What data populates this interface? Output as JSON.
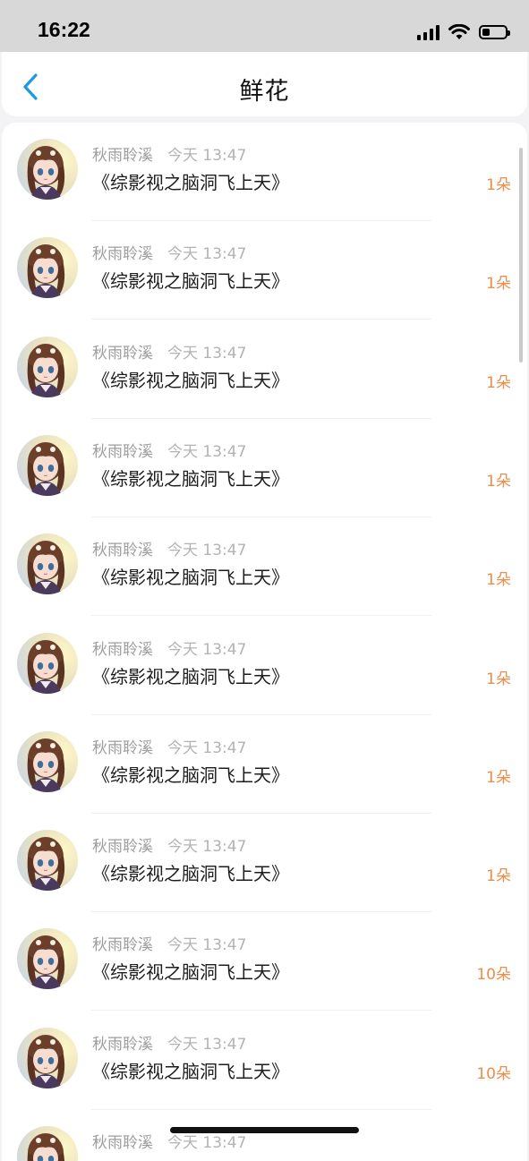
{
  "status_bar": {
    "time": "16:22"
  },
  "nav": {
    "title": "鲜花"
  },
  "list": [
    {
      "name": "秋雨聆溪",
      "time": "今天 13:47",
      "title": "《综影视之脑洞飞上天》",
      "count": "1朵"
    },
    {
      "name": "秋雨聆溪",
      "time": "今天 13:47",
      "title": "《综影视之脑洞飞上天》",
      "count": "1朵"
    },
    {
      "name": "秋雨聆溪",
      "time": "今天 13:47",
      "title": "《综影视之脑洞飞上天》",
      "count": "1朵"
    },
    {
      "name": "秋雨聆溪",
      "time": "今天 13:47",
      "title": "《综影视之脑洞飞上天》",
      "count": "1朵"
    },
    {
      "name": "秋雨聆溪",
      "time": "今天 13:47",
      "title": "《综影视之脑洞飞上天》",
      "count": "1朵"
    },
    {
      "name": "秋雨聆溪",
      "time": "今天 13:47",
      "title": "《综影视之脑洞飞上天》",
      "count": "1朵"
    },
    {
      "name": "秋雨聆溪",
      "time": "今天 13:47",
      "title": "《综影视之脑洞飞上天》",
      "count": "1朵"
    },
    {
      "name": "秋雨聆溪",
      "time": "今天 13:47",
      "title": "《综影视之脑洞飞上天》",
      "count": "1朵"
    },
    {
      "name": "秋雨聆溪",
      "time": "今天 13:47",
      "title": "《综影视之脑洞飞上天》",
      "count": "10朵"
    },
    {
      "name": "秋雨聆溪",
      "time": "今天 13:47",
      "title": "《综影视之脑洞飞上天》",
      "count": "10朵"
    },
    {
      "name": "秋雨聆溪",
      "time": "今天 13:47",
      "title": "",
      "count": ""
    }
  ],
  "colors": {
    "accent": "#1a9be0",
    "count": "#ee8c4a"
  },
  "icons": {
    "back": "back-chevron-icon",
    "avatar": "avatar-illustration-icon"
  }
}
